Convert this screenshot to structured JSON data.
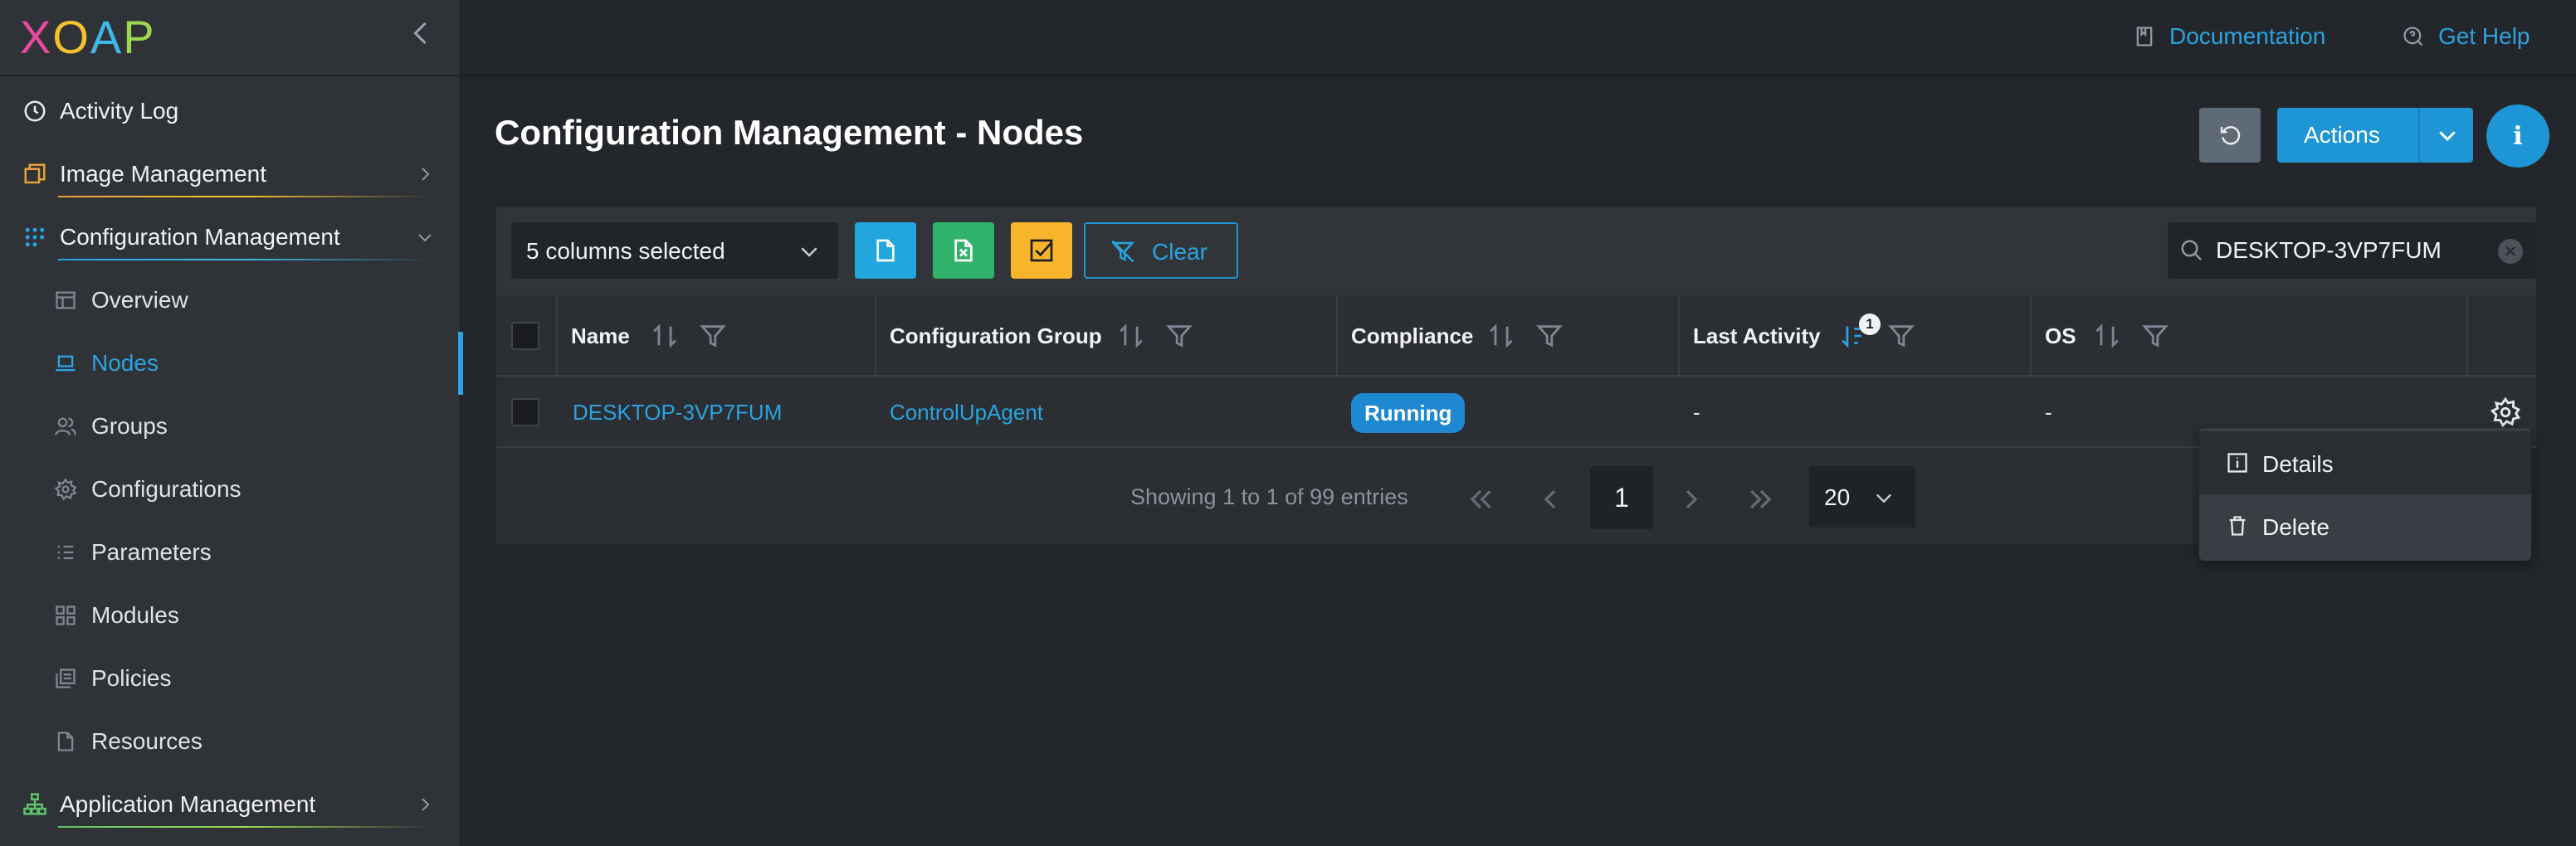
{
  "app": {
    "logo_letters": [
      "X",
      "O",
      "A",
      "P"
    ],
    "colors": {
      "accent": "#2aa3e0",
      "primary_button": "#1e95d4",
      "export_csv": "#22a6dd",
      "export_excel": "#2fb36b",
      "select_all": "#f7b52b",
      "running_badge": "#1e88d1"
    }
  },
  "topbar": {
    "documentation": "Documentation",
    "get_help": "Get Help"
  },
  "sidebar": {
    "items": [
      {
        "label": "Activity Log",
        "icon": "clock-icon"
      },
      {
        "label": "Image Management",
        "icon": "images-icon"
      },
      {
        "label": "Configuration Management",
        "icon": "grid-dots-icon"
      },
      {
        "label": "Application Management",
        "icon": "sitemap-icon"
      }
    ],
    "sub_items": [
      {
        "label": "Overview",
        "icon": "layout-icon"
      },
      {
        "label": "Nodes",
        "icon": "laptop-icon"
      },
      {
        "label": "Groups",
        "icon": "users-icon"
      },
      {
        "label": "Configurations",
        "icon": "gear-icon"
      },
      {
        "label": "Parameters",
        "icon": "list-icon"
      },
      {
        "label": "Modules",
        "icon": "modules-icon"
      },
      {
        "label": "Policies",
        "icon": "copy-icon"
      },
      {
        "label": "Resources",
        "icon": "file-icon"
      }
    ],
    "active_sub_item": "Nodes"
  },
  "page": {
    "title": "Configuration Management - Nodes",
    "actions_label": "Actions",
    "info_label": "i"
  },
  "toolbar": {
    "columns_selected": "5 columns selected",
    "clear_label": "Clear",
    "search_value": "DESKTOP-3VP7FUM"
  },
  "table": {
    "headers": [
      "Name",
      "Configuration Group",
      "Compliance",
      "Last Activity",
      "OS"
    ],
    "sort_badge": "1",
    "rows": [
      {
        "name": "DESKTOP-3VP7FUM",
        "group": "ControlUpAgent",
        "compliance": "Running",
        "last_activity": "-",
        "os": "-"
      }
    ]
  },
  "pagination": {
    "info": "Showing 1 to 1 of 99 entries",
    "current_page": "1",
    "page_size": "20"
  },
  "context_menu": {
    "items": [
      {
        "label": "Details",
        "icon": "info-box-icon"
      },
      {
        "label": "Delete",
        "icon": "trash-icon"
      }
    ]
  }
}
